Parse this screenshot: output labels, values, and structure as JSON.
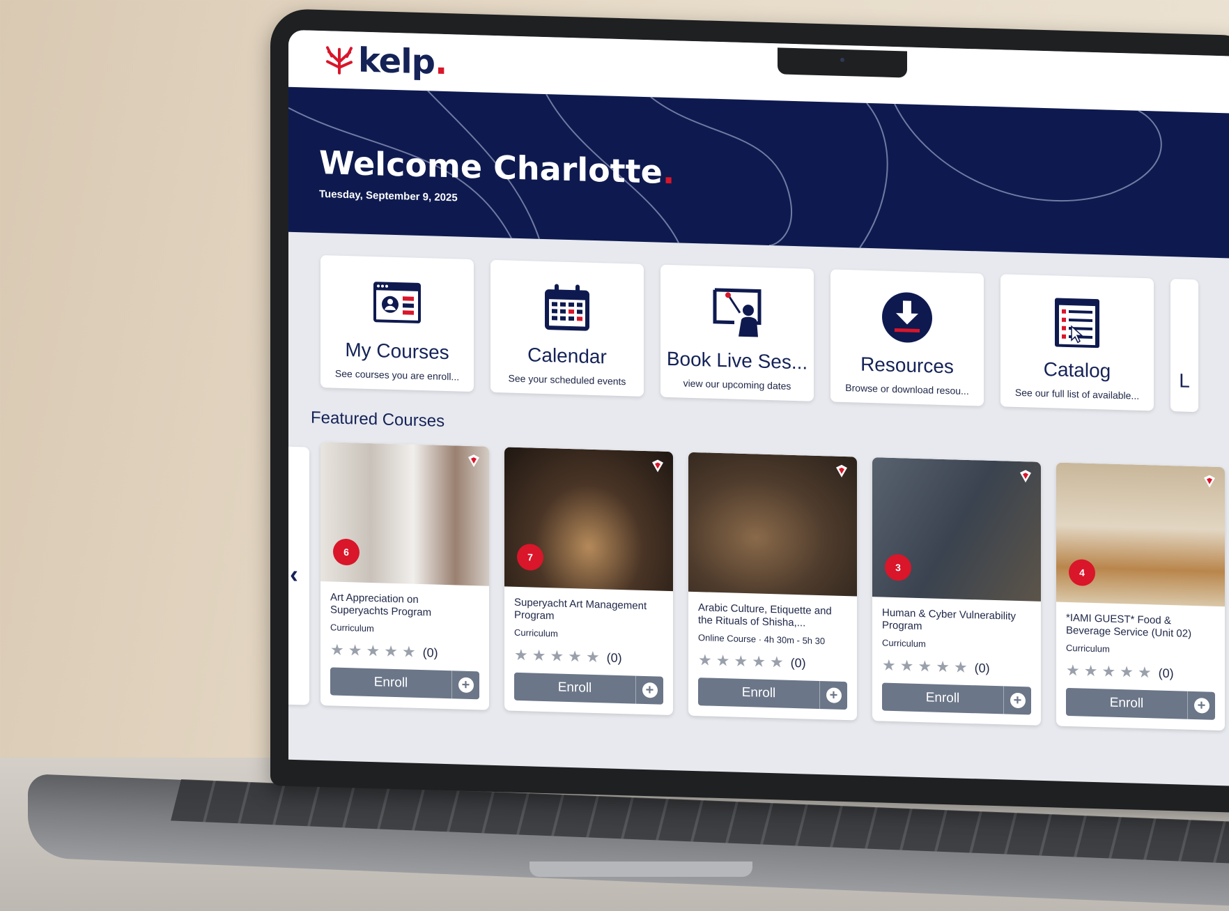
{
  "brand": {
    "name": "kelp",
    "dot": "."
  },
  "hero": {
    "greeting": "Welcome Charlotte",
    "greeting_dot": ".",
    "date": "Tuesday, September 9, 2025"
  },
  "tiles": [
    {
      "title": "My Courses",
      "subtitle": "See courses you are enroll...",
      "icon": "my-courses-icon"
    },
    {
      "title": "Calendar",
      "subtitle": "See your scheduled events",
      "icon": "calendar-icon"
    },
    {
      "title": "Book Live Ses...",
      "subtitle": "view our upcoming dates",
      "icon": "live-session-icon"
    },
    {
      "title": "Resources",
      "subtitle": "Browse or download resou...",
      "icon": "download-icon"
    },
    {
      "title": "Catalog",
      "subtitle": "See our full list of available...",
      "icon": "catalog-icon"
    }
  ],
  "partial_tile_letter": "L",
  "featured": {
    "heading": "Featured Courses",
    "courses": [
      {
        "badge": "6",
        "title": "Art Appreciation on Superyachts Program",
        "type": "Curriculum",
        "rating_count": "(0)",
        "enroll_label": "Enroll",
        "image_color": "#d8d4cf"
      },
      {
        "badge": "7",
        "title": "Superyacht Art Management Program",
        "type": "Curriculum",
        "rating_count": "(0)",
        "enroll_label": "Enroll",
        "image_color": "#3a2c22"
      },
      {
        "badge": "",
        "title": "Arabic Culture, Etiquette and the Rituals of Shisha,...",
        "type": "Online Course  · 4h 30m - 5h 30",
        "rating_count": "(0)",
        "enroll_label": "Enroll",
        "image_color": "#5b4a3a"
      },
      {
        "badge": "3",
        "title": "Human & Cyber Vulnerability Program",
        "type": "Curriculum",
        "rating_count": "(0)",
        "enroll_label": "Enroll",
        "image_color": "#3d4652"
      },
      {
        "badge": "4",
        "title": "*IAMI GUEST* Food & Beverage Service (Unit 02)",
        "type": "Curriculum",
        "rating_count": "(0)",
        "enroll_label": "Enroll",
        "image_color": "#a89a84"
      }
    ]
  },
  "colors": {
    "navy": "#0e1a4f",
    "accent_red": "#d9162a",
    "button_gray": "#6b7688"
  }
}
